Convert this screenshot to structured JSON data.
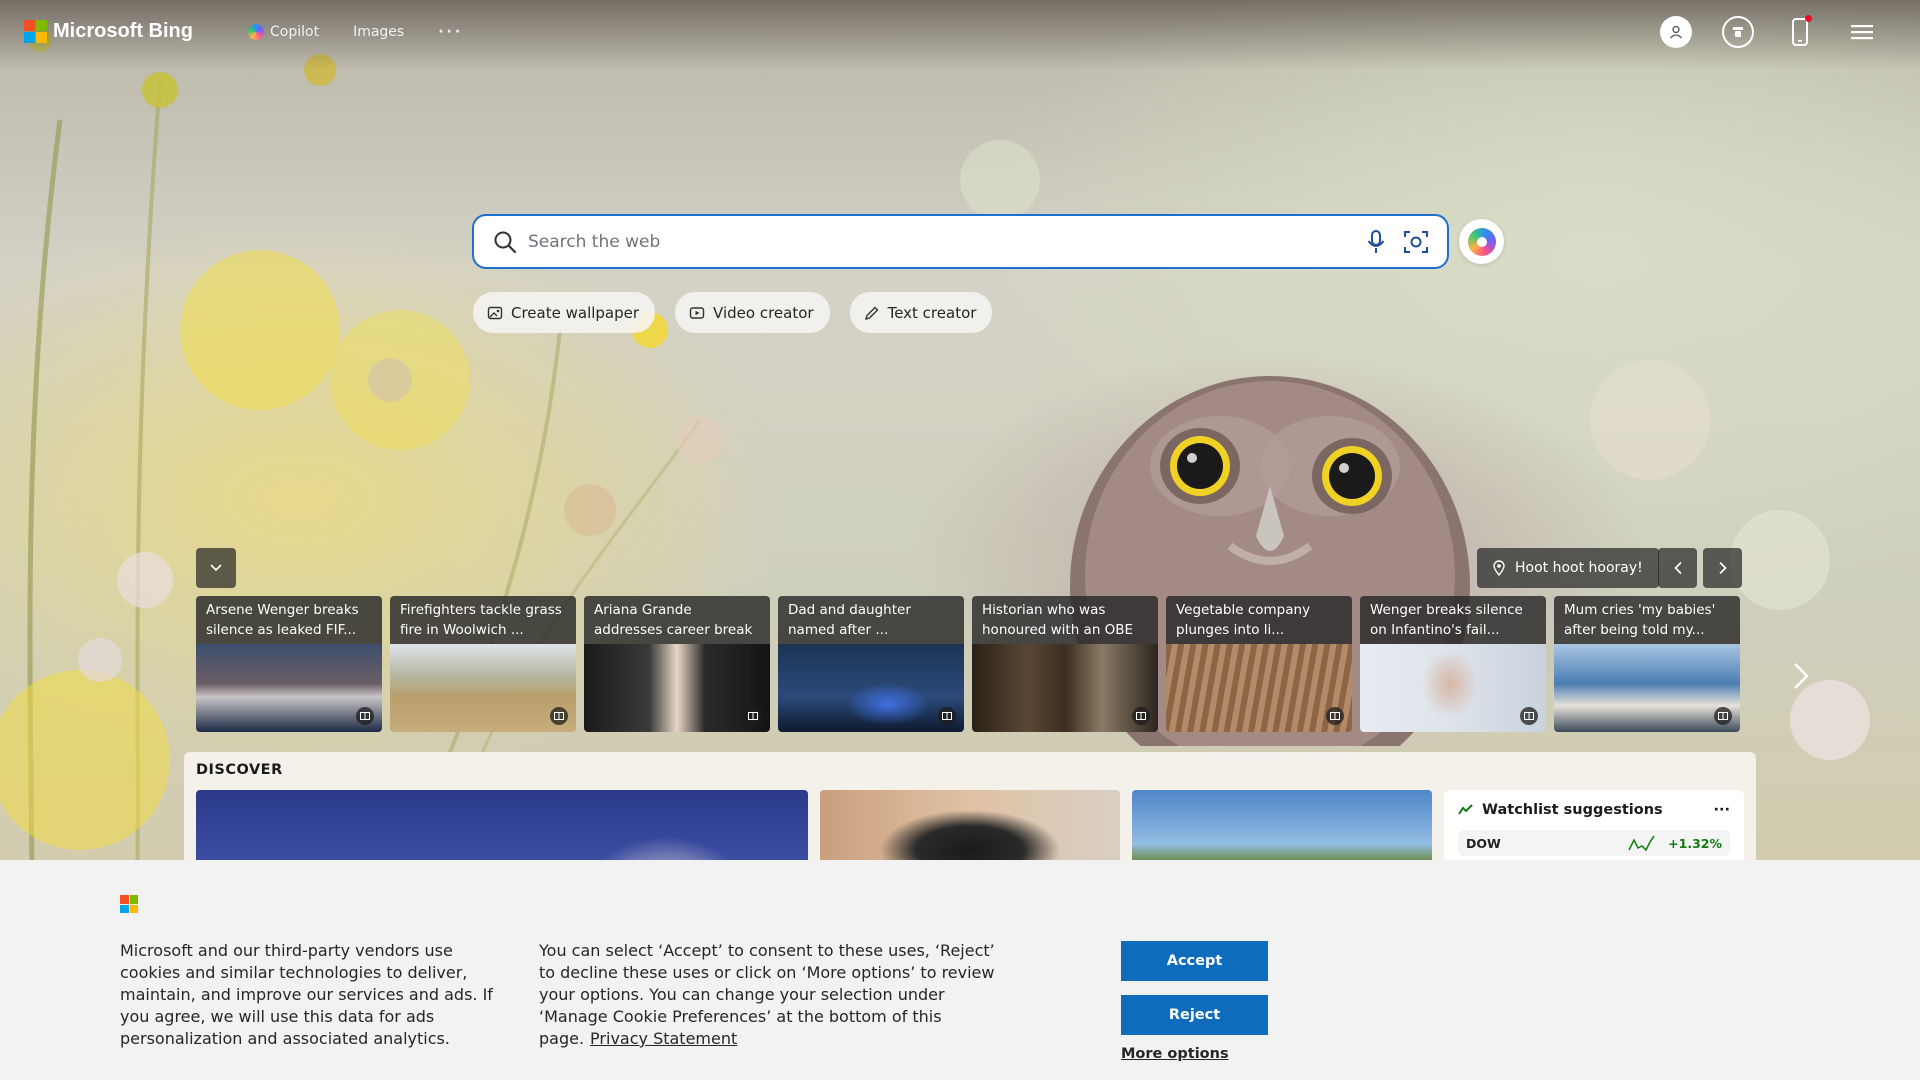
{
  "header": {
    "logo_text": "Microsoft Bing",
    "nav": [
      {
        "label": "Copilot"
      },
      {
        "label": "Images"
      },
      {
        "label": "···"
      }
    ]
  },
  "search": {
    "placeholder": "Search the web"
  },
  "chips": [
    {
      "label": "Create wallpaper"
    },
    {
      "label": "Video creator"
    },
    {
      "label": "Text creator"
    }
  ],
  "carousel": {
    "location_label": "Hoot hoot hooray!",
    "cards": [
      {
        "title": "Arsene Wenger breaks silence as leaked FIF..."
      },
      {
        "title": "Firefighters tackle grass fire in Woolwich ..."
      },
      {
        "title": "Ariana Grande addresses career break ..."
      },
      {
        "title": "Dad and daughter named after ..."
      },
      {
        "title": "Historian who was honoured with an OBE ..."
      },
      {
        "title": "Vegetable company plunges into li..."
      },
      {
        "title": "Wenger breaks silence on Infantino's fail..."
      },
      {
        "title": "Mum cries 'my babies' after being told my..."
      }
    ]
  },
  "discover": {
    "label": "DISCOVER",
    "watchlist": {
      "title": "Watchlist suggestions",
      "more": "···",
      "rows": [
        {
          "symbol": "DOW",
          "change": "+1.32%"
        }
      ]
    }
  },
  "cookie": {
    "text1": "Microsoft and our third-party vendors use cookies and similar technologies to deliver, maintain, and improve our services and ads. If you agree, we will use this data for ads personalization and associated analytics.",
    "text2": "You can select ‘Accept’ to consent to these uses, ‘Reject’ to decline these uses or click on ‘More options’ to review your options. You can change your selection under ‘Manage Cookie Preferences’ at the bottom of this page.",
    "privacy_link": "Privacy Statement",
    "accept": "Accept",
    "reject": "Reject",
    "more_options": "More options"
  },
  "colors": {
    "accent": "#0f6cbd",
    "search_border": "#1f6fd1",
    "ms_red": "#f25022",
    "ms_green": "#7fba00",
    "ms_blue": "#00a4ef",
    "ms_yellow": "#ffb900",
    "positive": "#107c10"
  }
}
